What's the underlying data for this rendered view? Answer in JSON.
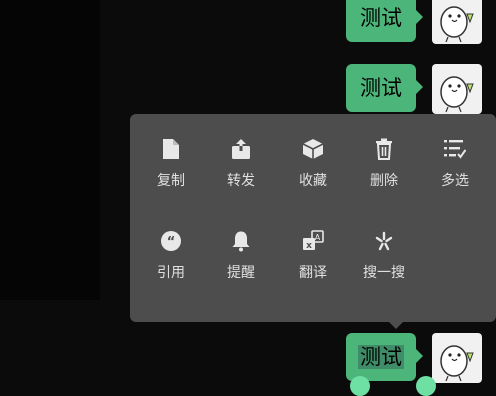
{
  "messages": [
    {
      "text": "测试"
    },
    {
      "text": "测试"
    },
    {
      "text": "测试"
    }
  ],
  "context_menu": {
    "items": [
      {
        "label": "复制",
        "icon": "copy-icon"
      },
      {
        "label": "转发",
        "icon": "forward-icon"
      },
      {
        "label": "收藏",
        "icon": "favorite-icon"
      },
      {
        "label": "删除",
        "icon": "delete-icon"
      },
      {
        "label": "多选",
        "icon": "multi-select-icon"
      },
      {
        "label": "引用",
        "icon": "quote-icon"
      },
      {
        "label": "提醒",
        "icon": "remind-icon"
      },
      {
        "label": "翻译",
        "icon": "translate-icon"
      },
      {
        "label": "搜一搜",
        "icon": "search-icon"
      }
    ]
  },
  "colors": {
    "background": "#0b0b0b",
    "bubble": "#4cb57a",
    "menu": "#4d4d4d",
    "selection_handle": "#6ee0a4"
  }
}
